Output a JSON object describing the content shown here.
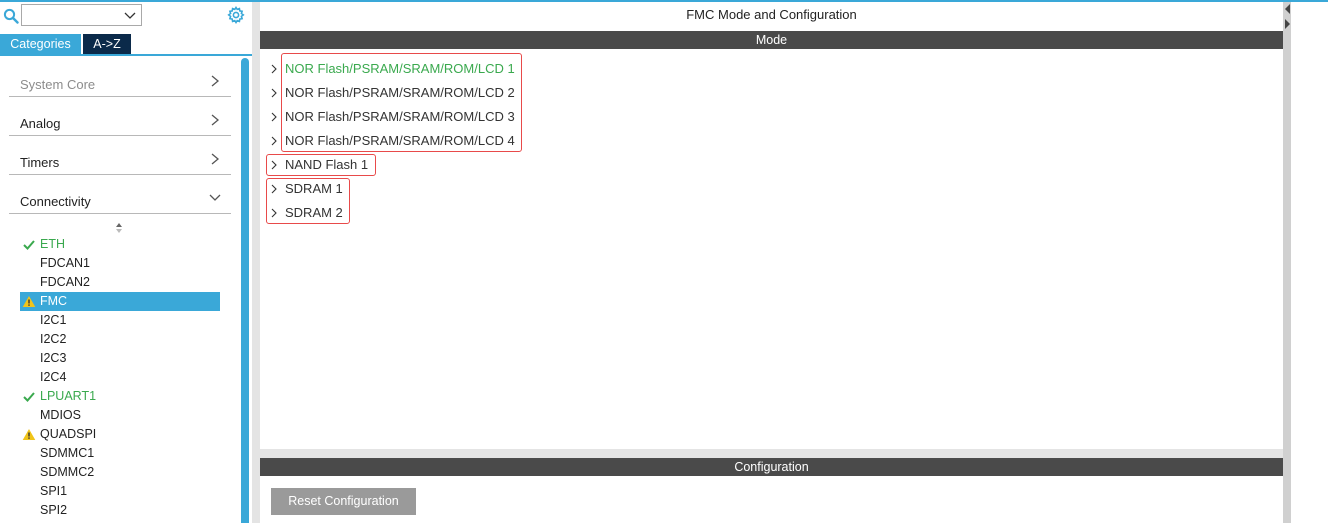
{
  "search": {
    "value": "",
    "placeholder": ""
  },
  "tabs": {
    "categories": "Categories",
    "az": "A->Z"
  },
  "categories": [
    {
      "label": "System Core",
      "state": "collapsed",
      "enabled": false
    },
    {
      "label": "Analog",
      "state": "collapsed",
      "enabled": true
    },
    {
      "label": "Timers",
      "state": "collapsed",
      "enabled": true
    },
    {
      "label": "Connectivity",
      "state": "expanded",
      "enabled": true
    }
  ],
  "connectivity_items": [
    {
      "label": "ETH",
      "status": "ok"
    },
    {
      "label": "FDCAN1",
      "status": "none"
    },
    {
      "label": "FDCAN2",
      "status": "none"
    },
    {
      "label": "FMC",
      "status": "warning",
      "selected": true
    },
    {
      "label": "I2C1",
      "status": "none"
    },
    {
      "label": "I2C2",
      "status": "none"
    },
    {
      "label": "I2C3",
      "status": "none"
    },
    {
      "label": "I2C4",
      "status": "none"
    },
    {
      "label": "LPUART1",
      "status": "ok"
    },
    {
      "label": "MDIOS",
      "status": "none"
    },
    {
      "label": "QUADSPI",
      "status": "warning"
    },
    {
      "label": "SDMMC1",
      "status": "none"
    },
    {
      "label": "SDMMC2",
      "status": "none"
    },
    {
      "label": "SPI1",
      "status": "none"
    },
    {
      "label": "SPI2",
      "status": "none"
    }
  ],
  "main": {
    "title": "FMC Mode and Configuration",
    "mode_header": "Mode",
    "config_header": "Configuration",
    "mode_items": [
      {
        "label": "NOR Flash/PSRAM/SRAM/ROM/LCD 1",
        "active": true
      },
      {
        "label": "NOR Flash/PSRAM/SRAM/ROM/LCD 2",
        "active": false
      },
      {
        "label": "NOR Flash/PSRAM/SRAM/ROM/LCD 3",
        "active": false
      },
      {
        "label": "NOR Flash/PSRAM/SRAM/ROM/LCD 4",
        "active": false
      },
      {
        "label": "NAND Flash 1",
        "active": false
      },
      {
        "label": "SDRAM 1",
        "active": false
      },
      {
        "label": "SDRAM 2",
        "active": false
      }
    ],
    "reset_button": "Reset Configuration"
  },
  "colors": {
    "accent": "#3aa8d8",
    "ok": "#3aa94e",
    "warning": "#f0c419",
    "header_bar": "#4a4a4a",
    "highlight_box": "#e84a4a"
  },
  "icons": [
    "search-icon",
    "chevron-down-icon",
    "gear-icon",
    "chevron-right-icon",
    "check-icon",
    "warning-icon",
    "sort-icon"
  ]
}
